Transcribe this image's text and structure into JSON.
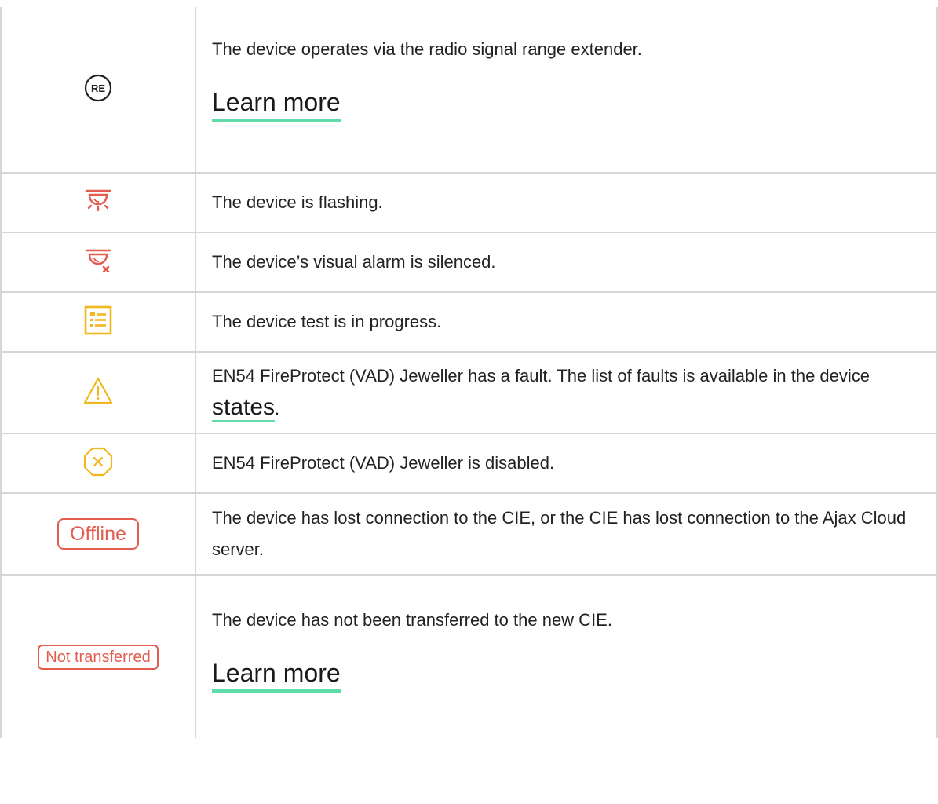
{
  "rows": [
    {
      "icon": "range-extender-icon",
      "icon_text": "RE",
      "text": "The device operates via the radio signal range extender.",
      "link": "Learn more"
    },
    {
      "icon": "flashing-siren-icon",
      "text": "The device is flashing."
    },
    {
      "icon": "siren-silenced-icon",
      "text": "The device’s visual alarm is silenced."
    },
    {
      "icon": "test-list-icon",
      "text": "The device test is in progress."
    },
    {
      "icon": "warning-triangle-icon",
      "text_before": "EN54 FireProtect (VAD) Jeweller has a fault. The list of faults is available in the device ",
      "link": "states",
      "text_after": "."
    },
    {
      "icon": "disabled-octagon-icon",
      "text": "EN54 FireProtect (VAD) Jeweller is disabled."
    },
    {
      "badge": "Offline",
      "text": "The device has lost connection to the CIE, or the CIE has lost connection to the Ajax Cloud server."
    },
    {
      "badge": "Not transferred",
      "text": "The device has not been transferred to the new CIE.",
      "link": "Learn more"
    }
  ],
  "colors": {
    "red": "#e45c4f",
    "yellow": "#f0b81c",
    "link_underline": "#5fdca8",
    "border": "#d6d6d6"
  }
}
